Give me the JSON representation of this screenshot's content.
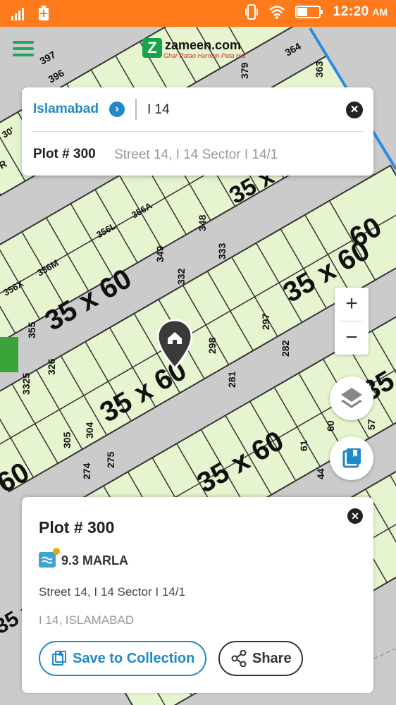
{
  "status_bar": {
    "time": "12:20",
    "ampm": "AM"
  },
  "header": {
    "logo_text": "zameen.com",
    "logo_tagline": "Ghar Patao Humain Pata Hai"
  },
  "search": {
    "city": "Islamabad",
    "query": "I 14",
    "result_title": "Plot # 300",
    "result_subtitle": "Street 14, I 14 Sector I 14/1"
  },
  "map": {
    "labels": [
      "397",
      "396",
      "364",
      "379",
      "363",
      "30'",
      "R",
      "35 x 60",
      "356L",
      "356A",
      "348",
      "333",
      "349",
      "332",
      "356X",
      "356M",
      "35 x 60",
      "297",
      "282",
      "35 x 60",
      "355",
      "326",
      "35 x 60",
      "298",
      "281",
      "3325",
      "35 x 60",
      "304",
      "275",
      "305",
      "274",
      "60",
      "61",
      "44",
      "60",
      "35",
      "60",
      "57",
      "35 x 60"
    ]
  },
  "zoom": {
    "in_label": "+",
    "out_label": "−"
  },
  "detail": {
    "title": "Plot # 300",
    "area": "9.3 MARLA",
    "address": "Street 14, I 14 Sector I 14/1",
    "locality": "I 14, ISLAMABAD",
    "save_label": "Save to Collection",
    "share_label": "Share"
  }
}
